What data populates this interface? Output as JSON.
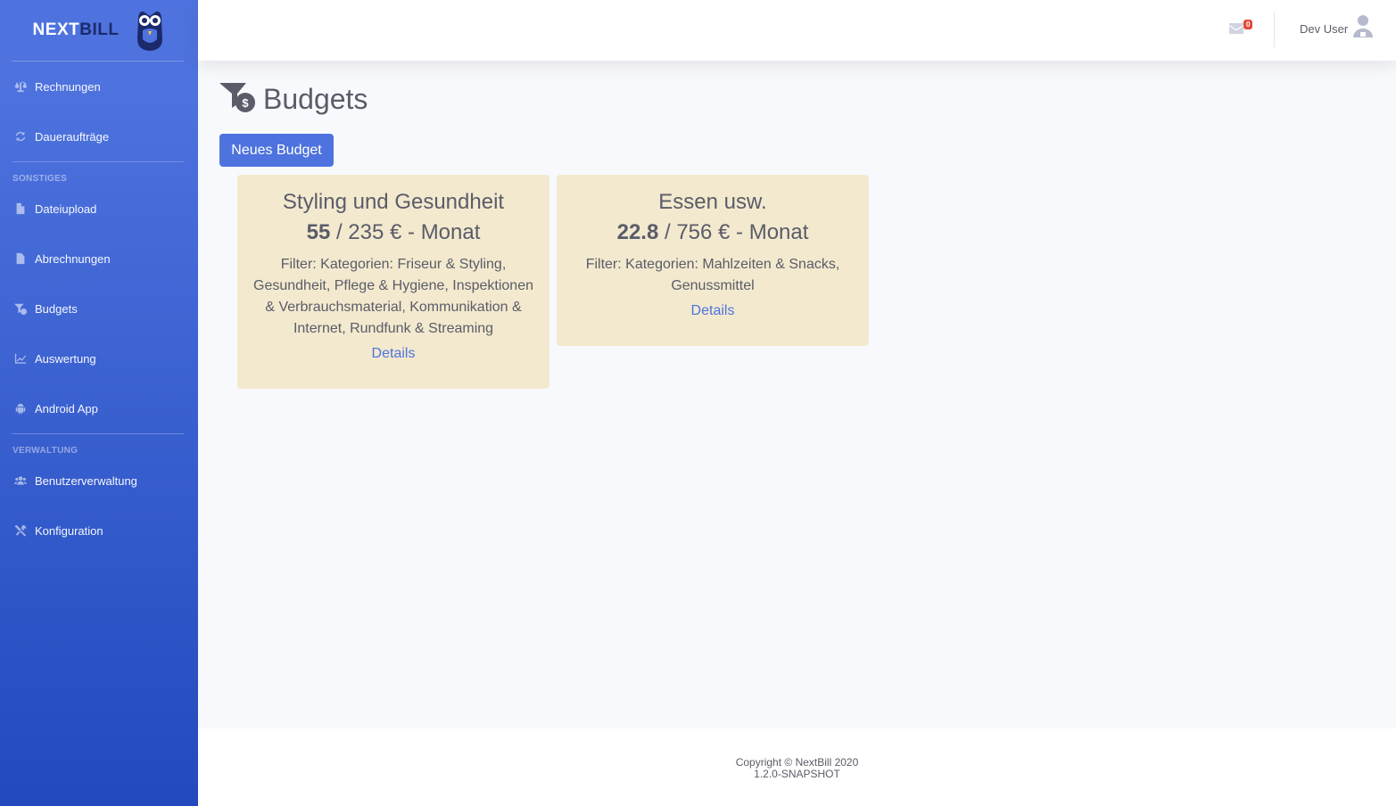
{
  "brand": {
    "part1": "NEXT",
    "part2": "BILL"
  },
  "sidebar": {
    "items_top": [
      {
        "label": "Rechnungen",
        "icon": "balance-scale-icon"
      },
      {
        "label": "Daueraufträge",
        "icon": "sync-icon"
      }
    ],
    "heading_sonstiges": "SONSTIGES",
    "items_sonstiges": [
      {
        "label": "Dateiupload",
        "icon": "file-icon"
      },
      {
        "label": "Abrechnungen",
        "icon": "file-invoice-icon"
      },
      {
        "label": "Budgets",
        "icon": "funnel-dollar-icon"
      },
      {
        "label": "Auswertung",
        "icon": "chart-line-icon"
      },
      {
        "label": "Android App",
        "icon": "android-icon"
      }
    ],
    "heading_verwaltung": "VERWALTUNG",
    "items_verwaltung": [
      {
        "label": "Benutzerverwaltung",
        "icon": "users-icon"
      },
      {
        "label": "Konfiguration",
        "icon": "tools-icon"
      }
    ]
  },
  "topbar": {
    "mail_count": "0",
    "user_name": "Dev User"
  },
  "main": {
    "title": "Budgets",
    "new_button": "Neues Budget",
    "cards": [
      {
        "title": "Styling und Gesundheit",
        "spent": "55",
        "rest": " / 235 € - Monat",
        "filter": "Filter: Kategorien: Friseur & Styling, Gesundheit, Pflege & Hygiene, Inspektionen & Verbrauchsmaterial, Kommunikation & Internet, Rundfunk & Streaming",
        "link": "Details"
      },
      {
        "title": "Essen usw.",
        "spent": "22.8",
        "rest": " / 756 € - Monat",
        "filter": "Filter: Kategorien: Mahlzeiten & Snacks, Genussmittel",
        "link": "Details"
      }
    ]
  },
  "footer": {
    "copyright": "Copyright © NextBill 2020",
    "version": "1.2.0-SNAPSHOT"
  },
  "colors": {
    "primary": "#4e73df",
    "card_bg": "#f3e9ce",
    "badge": "#e74a3b"
  }
}
